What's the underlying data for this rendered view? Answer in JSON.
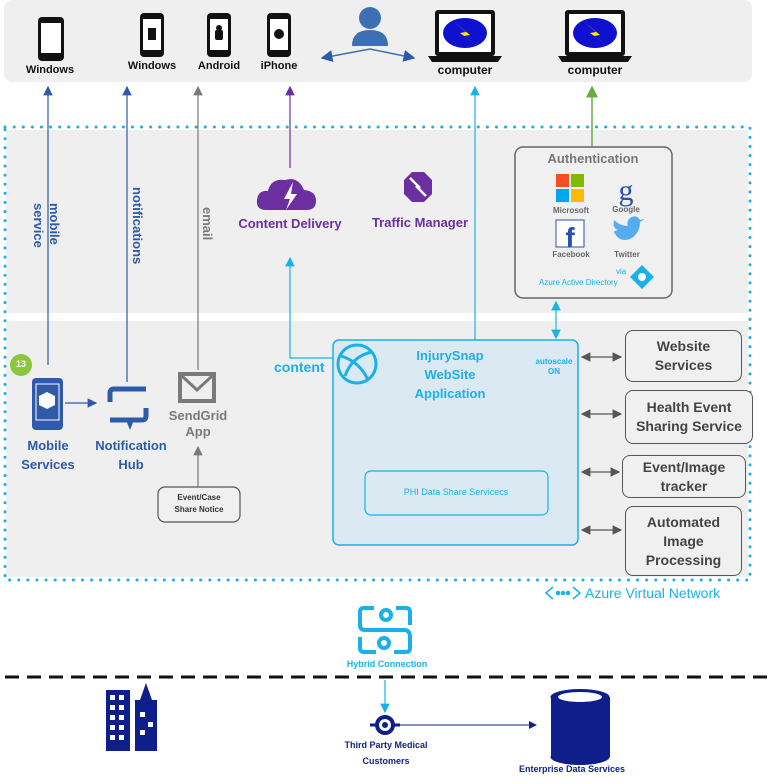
{
  "devices": [
    {
      "label": "Windows",
      "icon": "phone-icon"
    },
    {
      "label": "Windows",
      "icon": "windows-phone-icon"
    },
    {
      "label": "Android",
      "icon": "android-phone-icon"
    },
    {
      "label": "iPhone",
      "icon": "iphone-icon"
    },
    {
      "label": "computer",
      "icon": "laptop-icon"
    },
    {
      "label": "computer",
      "icon": "laptop-icon"
    }
  ],
  "channels": {
    "mobile_service": "mobile\nservice",
    "mobile_service_1": "mobile",
    "mobile_service_2": "service",
    "notifications": "notifications",
    "email": "email",
    "content": "content"
  },
  "cdn": {
    "label": "Content Delivery"
  },
  "traffic": {
    "label": "Traffic Manager"
  },
  "auth": {
    "title": "Authentication",
    "providers": [
      "Microsoft",
      "Google",
      "Facebook",
      "Twitter"
    ],
    "via": "via",
    "aad": "Azure Active Directory"
  },
  "mobile": {
    "badge": "13",
    "label1": "Mobile",
    "label2": "Services"
  },
  "hub": {
    "label1": "Notification",
    "label2": "Hub"
  },
  "sendgrid": {
    "label1": "SendGrid",
    "label2": "App"
  },
  "notice": {
    "line1": "Event/Case",
    "line2": "Share Notice"
  },
  "webapp": {
    "title1": "InjurySnap",
    "title2": "WebSite",
    "title3": "Application",
    "autoscale1": "autoscale",
    "autoscale2": "ON",
    "inner": "PHI Data Share Servicecs"
  },
  "services": [
    {
      "l1": "Website",
      "l2": "Services"
    },
    {
      "l1": "Health Event",
      "l2": "Sharing Service"
    },
    {
      "l1": "Event/Image",
      "l2": "tracker"
    },
    {
      "l1": "Automated",
      "l2": "Image",
      "l3": "Processing"
    }
  ],
  "vnet": {
    "label": "Azure Virtual Network"
  },
  "hybrid": {
    "label": "Hybrid Connection"
  },
  "third_party": {
    "l1": "Third Party Medical",
    "l2": "Customers"
  },
  "enterprise": {
    "label": "Enterprise Data Services"
  },
  "colors": {
    "blue": "#2f5aa8",
    "cyan": "#1ab0e8",
    "purple": "#6b2fa0",
    "gray": "#7a7a7a",
    "green": "#6aaa44",
    "navy": "#0e1f8c"
  }
}
